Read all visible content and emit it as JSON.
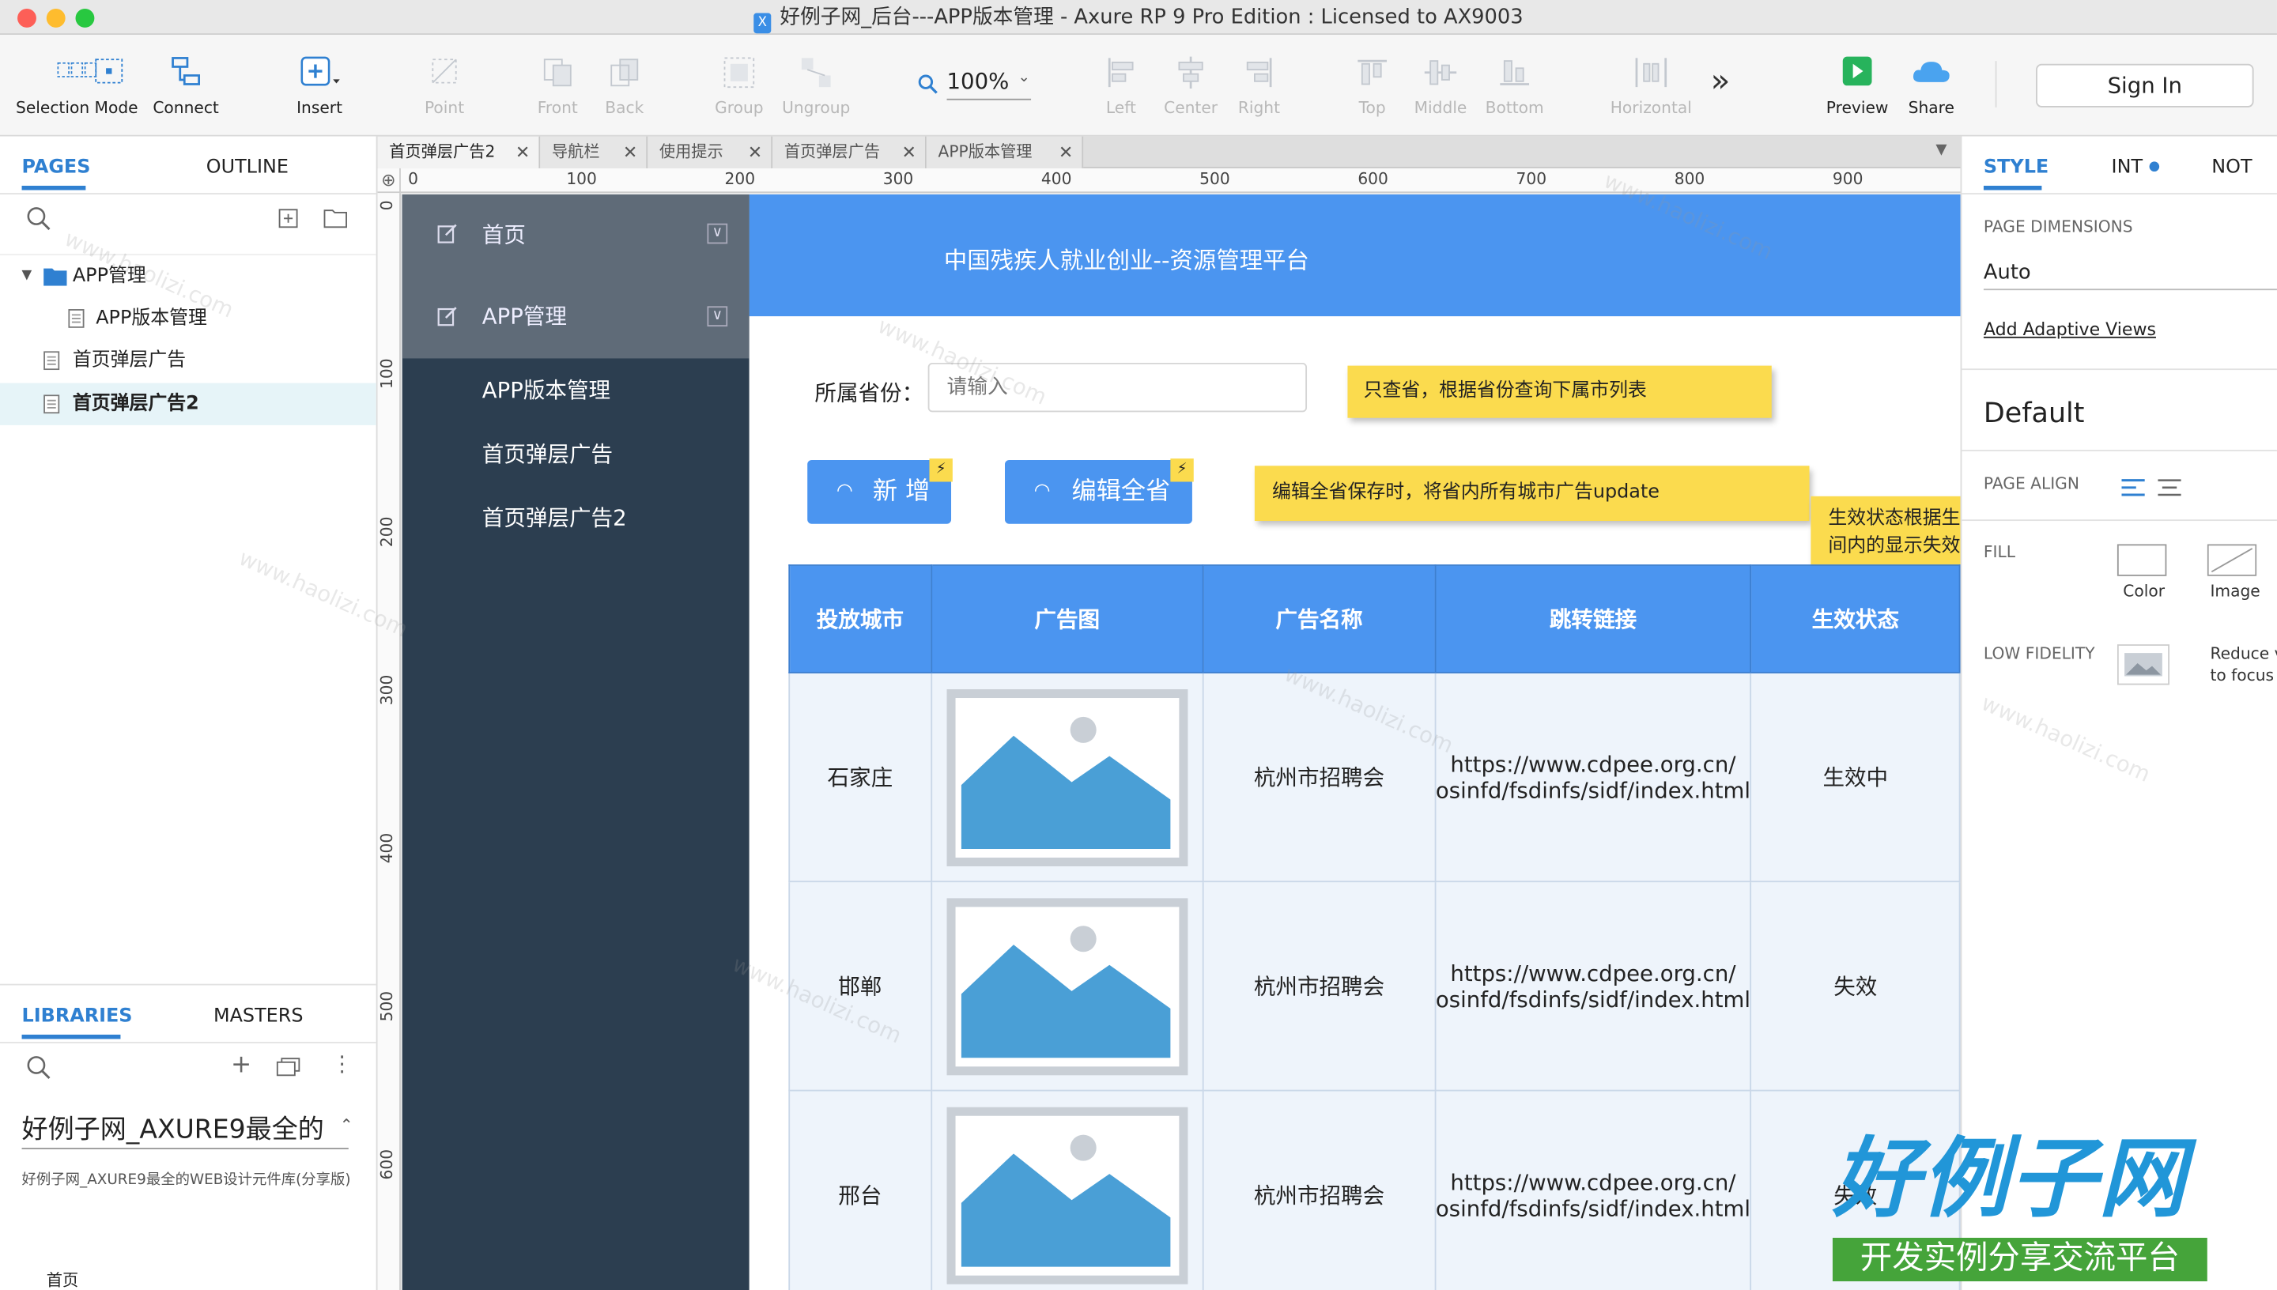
{
  "window": {
    "title": "好例子网_后台---APP版本管理 - Axure RP 9 Pro Edition : Licensed to AX9003"
  },
  "toolbar": {
    "selection_mode": "Selection Mode",
    "connect": "Connect",
    "insert": "Insert",
    "point": "Point",
    "front": "Front",
    "back": "Back",
    "group": "Group",
    "ungroup": "Ungroup",
    "zoom": "100%",
    "left": "Left",
    "center": "Center",
    "right": "Right",
    "top": "Top",
    "middle": "Middle",
    "bottom": "Bottom",
    "horizontal": "Horizontal",
    "more": "»",
    "preview": "Preview",
    "share": "Share",
    "sign_in": "Sign In"
  },
  "left_panel": {
    "tabs": [
      "PAGES",
      "OUTLINE"
    ],
    "pages": [
      {
        "label": "APP管理",
        "type": "folder"
      },
      {
        "label": "APP版本管理",
        "type": "page"
      },
      {
        "label": "首页弹层广告",
        "type": "page"
      },
      {
        "label": "首页弹层广告2",
        "type": "page",
        "selected": true
      }
    ],
    "lib_tabs": [
      "LIBRARIES",
      "MASTERS"
    ],
    "library_name": "好例子网_AXURE9最全的",
    "library_desc": "好例子网_AXURE9最全的WEB设计元件库(分享版)",
    "footer": "首页"
  },
  "doc_tabs": [
    "首页弹层广告2",
    "导航栏",
    "使用提示",
    "首页弹层广告",
    "APP版本管理"
  ],
  "ruler": {
    "h": [
      "0",
      "100",
      "200",
      "300",
      "400",
      "500",
      "600",
      "700",
      "800",
      "900"
    ],
    "v": [
      "0",
      "100",
      "200",
      "300",
      "400",
      "500",
      "600"
    ]
  },
  "design": {
    "nav": {
      "groups": [
        "首页",
        "APP管理"
      ],
      "items": [
        "APP版本管理",
        "首页弹层广告",
        "首页弹层广告2"
      ]
    },
    "header_title": "中国残疾人就业创业--资源管理平台",
    "province_label": "所属省份：",
    "province_placeholder": "请输入",
    "note1": "只查省，根据省份查询下属市列表",
    "note2": "编辑全省保存时，将省内所有城市广告update",
    "note3_line1": "生效状态根据生",
    "note3_line2": "间内的显示失效",
    "btn_add": "新 增",
    "btn_edit": "编辑全省",
    "table_headers": [
      "投放城市",
      "广告图",
      "广告名称",
      "跳转链接",
      "生效状态"
    ],
    "rows": [
      {
        "city": "石家庄",
        "name": "杭州市招聘会",
        "link1": "https://www.cdpee.org.cn/",
        "link2": "osinfd/fsdinfs/sidf/index.html",
        "status": "生效中"
      },
      {
        "city": "邯郸",
        "name": "杭州市招聘会",
        "link1": "https://www.cdpee.org.cn/",
        "link2": "osinfd/fsdinfs/sidf/index.html",
        "status": "失效"
      },
      {
        "city": "邢台",
        "name": "杭州市招聘会",
        "link1": "https://www.cdpee.org.cn/",
        "link2": "osinfd/fsdinfs/sidf/index.html",
        "status": "失效"
      }
    ]
  },
  "right_panel": {
    "tabs": [
      "STYLE",
      "INT",
      "NOT"
    ],
    "page_dimensions_label": "PAGE DIMENSIONS",
    "page_dimensions_value": "Auto",
    "add_adaptive": "Add Adaptive Views",
    "default_label": "Default",
    "page_align_label": "PAGE ALIGN",
    "fill_label": "FILL",
    "fill_color": "Color",
    "fill_image": "Image",
    "low_fidelity_label": "LOW FIDELITY",
    "low_fidelity_desc1": "Reduce v",
    "low_fidelity_desc2": "to focus c"
  },
  "watermark": {
    "text": "www.haolizi.com",
    "logo_title": "好例子网",
    "logo_sub": "开发实例分享交流平台"
  },
  "colors": {
    "accent": "#2f80d1",
    "design_blue": "#4b95f0",
    "nav_dark": "#2c3e50",
    "note_yellow": "#fbdb4e"
  }
}
